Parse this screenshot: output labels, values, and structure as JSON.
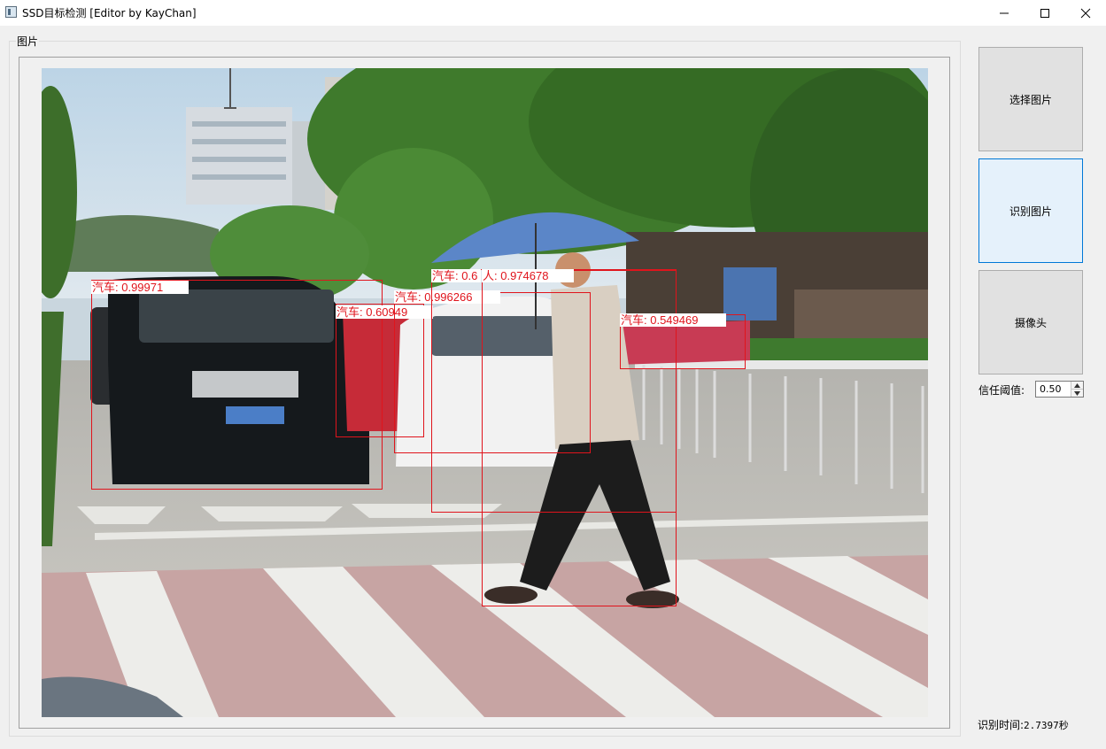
{
  "window": {
    "title": "SSD目标检测 [Editor by KayChan]",
    "icon": "app-window-icon",
    "controls": [
      "minimize-icon",
      "maximize-icon",
      "close-icon"
    ]
  },
  "image_group": {
    "label": "图片"
  },
  "detections": [
    {
      "label": "汽车: 0.99971"
    },
    {
      "label": "汽车: 0.60949"
    },
    {
      "label": "汽车: 0.996266"
    },
    {
      "label": "汽车: 0.6"
    },
    {
      "label": "人: 0.974678"
    },
    {
      "label": "汽车: 0.549469"
    }
  ],
  "buttons": {
    "select_image": "选择图片",
    "detect_image": "识别图片",
    "camera": "摄像头"
  },
  "threshold": {
    "label": "信任阈值:",
    "value": "0.50"
  },
  "detection_time": {
    "label": "识别时间:",
    "value": "2.7397秒"
  },
  "colors": {
    "box": "#e0141c",
    "active_button_border": "#0078d7",
    "active_button_bg": "#e5f1fb"
  }
}
